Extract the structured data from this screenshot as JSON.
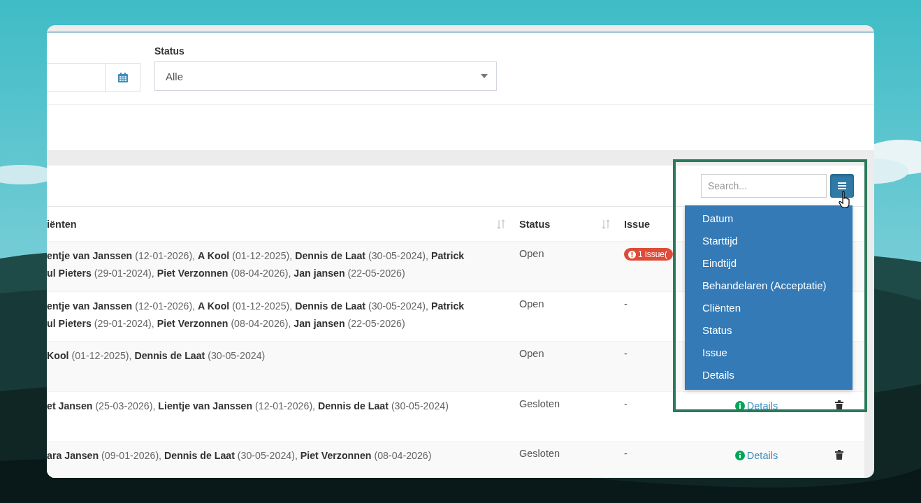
{
  "filters": {
    "status": {
      "label": "Status",
      "value": "Alle"
    }
  },
  "table": {
    "search": {
      "placeholder": "Search..."
    },
    "columns": [
      {
        "label": "iënten",
        "sortable": true
      },
      {
        "label": "Status",
        "sortable": true
      },
      {
        "label": "Issue",
        "sortable": false
      }
    ],
    "rows": [
      {
        "clients": [
          "**entje van Janssen** (12-01-2026), **A Kool** (01-12-2025), **Dennis de Laat** (30-05-2024), **Patrick**",
          "**ul Pieters** (29-01-2024), **Piet Verzonnen** (08-04-2026), **Jan jansen** (22-05-2026)"
        ],
        "status": "Open",
        "issue": {
          "kind": "badge",
          "text": "1 issue("
        }
      },
      {
        "clients": [
          "**entje van Janssen** (12-01-2026), **A Kool** (01-12-2025), **Dennis de Laat** (30-05-2024), **Patrick**",
          "**ul Pieters** (29-01-2024), **Piet Verzonnen** (08-04-2026), **Jan jansen** (22-05-2026)"
        ],
        "status": "Open",
        "issue": {
          "kind": "text",
          "text": "-"
        }
      },
      {
        "clients": [
          "**Kool** (01-12-2025), **Dennis de Laat** (30-05-2024)"
        ],
        "status": "Open",
        "issue": {
          "kind": "text",
          "text": "-"
        }
      },
      {
        "clients": [
          "**et Jansen** (25-03-2026), **Lientje van Janssen** (12-01-2026), **Dennis de Laat** (30-05-2024)"
        ],
        "status": "Gesloten",
        "issue": {
          "kind": "text",
          "text": "-"
        },
        "details": "Details"
      },
      {
        "clients": [
          "**ara Jansen** (09-01-2026), **Dennis de Laat** (30-05-2024), **Piet Verzonnen** (08-04-2026)"
        ],
        "status": "Gesloten",
        "issue": {
          "kind": "text",
          "text": "-"
        },
        "details": "Details"
      }
    ],
    "column_menu": {
      "open": true,
      "items": [
        "Datum",
        "Starttijd",
        "Eindtijd",
        "Behandelaren (Acceptatie)",
        "Cliënten",
        "Status",
        "Issue",
        "Details"
      ]
    }
  }
}
